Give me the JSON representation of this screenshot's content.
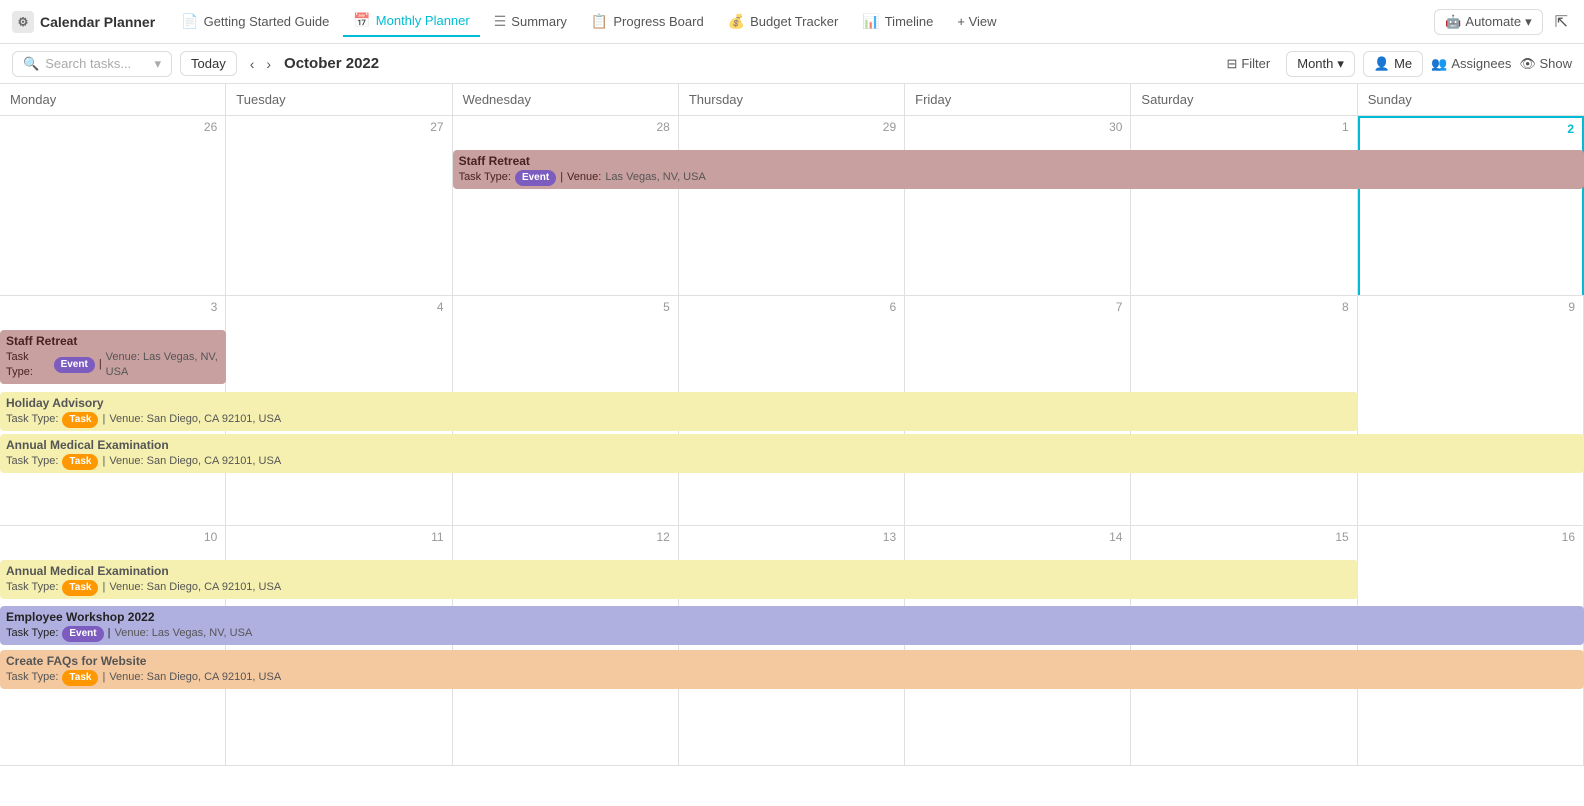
{
  "app": {
    "title": "Calendar Planner",
    "logo_char": "⚙"
  },
  "nav": {
    "tabs": [
      {
        "id": "getting-started",
        "label": "Getting Started Guide",
        "icon": "📄",
        "active": false
      },
      {
        "id": "monthly-planner",
        "label": "Monthly Planner",
        "icon": "📅",
        "active": true
      },
      {
        "id": "summary",
        "label": "Summary",
        "icon": "☰",
        "active": false
      },
      {
        "id": "progress-board",
        "label": "Progress Board",
        "icon": "📋",
        "active": false
      },
      {
        "id": "budget-tracker",
        "label": "Budget Tracker",
        "icon": "💰",
        "active": false
      },
      {
        "id": "timeline",
        "label": "Timeline",
        "icon": "📊",
        "active": false
      },
      {
        "id": "view",
        "label": "+ View",
        "icon": "",
        "active": false
      }
    ],
    "automate_label": "Automate",
    "share_icon": "⇱"
  },
  "toolbar": {
    "search_placeholder": "Search tasks...",
    "today_label": "Today",
    "current_month": "October 2022",
    "filter_label": "Filter",
    "month_label": "Month",
    "me_label": "Me",
    "assignees_label": "Assignees",
    "show_label": "Show"
  },
  "calendar": {
    "day_headers": [
      "Monday",
      "Tuesday",
      "Wednesday",
      "Thursday",
      "Friday",
      "Saturday",
      "Sunday"
    ],
    "weeks": [
      {
        "id": "week1",
        "days": [
          {
            "num": "26",
            "highlight": false,
            "sunday": false
          },
          {
            "num": "27",
            "highlight": false,
            "sunday": false
          },
          {
            "num": "28",
            "highlight": false,
            "sunday": false
          },
          {
            "num": "29",
            "highlight": false,
            "sunday": false
          },
          {
            "num": "30",
            "highlight": false,
            "sunday": false
          },
          {
            "num": "1",
            "highlight": false,
            "sunday": false
          },
          {
            "num": "2",
            "highlight": true,
            "sunday": true
          }
        ],
        "spanning_events": [
          {
            "title": "Staff Retreat",
            "task_type_label": "Task Type:",
            "badge_label": "Event",
            "badge_class": "badge-event",
            "venue_label": "Venue:",
            "venue": "Las Vegas, NV, USA",
            "color": "color-mauve",
            "col_start": 3,
            "col_span": 5
          }
        ]
      },
      {
        "id": "week2",
        "days": [
          {
            "num": "3",
            "highlight": false,
            "sunday": false
          },
          {
            "num": "4",
            "highlight": false,
            "sunday": false
          },
          {
            "num": "5",
            "highlight": false,
            "sunday": false
          },
          {
            "num": "6",
            "highlight": false,
            "sunday": false
          },
          {
            "num": "7",
            "highlight": false,
            "sunday": false
          },
          {
            "num": "8",
            "highlight": false,
            "sunday": false
          },
          {
            "num": "9",
            "highlight": false,
            "sunday": false
          }
        ],
        "spanning_events": [
          {
            "title": "Staff Retreat",
            "task_type_label": "Task Type:",
            "badge_label": "Event",
            "badge_class": "badge-event",
            "venue_label": "Venue:",
            "venue": "Las Vegas, NV, USA",
            "color": "color-mauve",
            "col_start": 1,
            "col_span": 1
          },
          {
            "title": "Holiday Advisory",
            "task_type_label": "Task Type:",
            "badge_label": "Task",
            "badge_class": "badge-task",
            "venue_label": "Venue:",
            "venue": "San Diego, CA 92101, USA",
            "color": "color-yellow",
            "col_start": 1,
            "col_span": 6
          },
          {
            "title": "Annual Medical Examination",
            "task_type_label": "Task Type:",
            "badge_label": "Task",
            "badge_class": "badge-task",
            "venue_label": "Venue:",
            "venue": "San Diego, CA 92101, USA",
            "color": "color-yellow",
            "col_start": 1,
            "col_span": 7
          }
        ]
      },
      {
        "id": "week3",
        "days": [
          {
            "num": "10",
            "highlight": false,
            "sunday": false
          },
          {
            "num": "11",
            "highlight": false,
            "sunday": false
          },
          {
            "num": "12",
            "highlight": false,
            "sunday": false
          },
          {
            "num": "13",
            "highlight": false,
            "sunday": false
          },
          {
            "num": "14",
            "highlight": false,
            "sunday": false
          },
          {
            "num": "15",
            "highlight": false,
            "sunday": false
          },
          {
            "num": "16",
            "highlight": false,
            "sunday": false
          }
        ],
        "spanning_events": [
          {
            "title": "Annual Medical Examination",
            "task_type_label": "Task Type:",
            "badge_label": "Task",
            "badge_class": "badge-task",
            "venue_label": "Venue:",
            "venue": "San Diego, CA 92101, USA",
            "color": "color-yellow",
            "col_start": 1,
            "col_span": 6
          },
          {
            "title": "Employee Workshop 2022",
            "task_type_label": "Task Type:",
            "badge_label": "Event",
            "badge_class": "badge-event",
            "venue_label": "Venue:",
            "venue": "Las Vegas, NV, USA",
            "color": "color-blue-purple",
            "col_start": 1,
            "col_span": 7
          },
          {
            "title": "Create FAQs for Website",
            "task_type_label": "Task Type:",
            "badge_label": "Task",
            "badge_class": "badge-task",
            "venue_label": "Venue:",
            "venue": "San Diego, CA 92101, USA",
            "color": "color-peach",
            "col_start": 1,
            "col_span": 7
          }
        ]
      }
    ]
  }
}
